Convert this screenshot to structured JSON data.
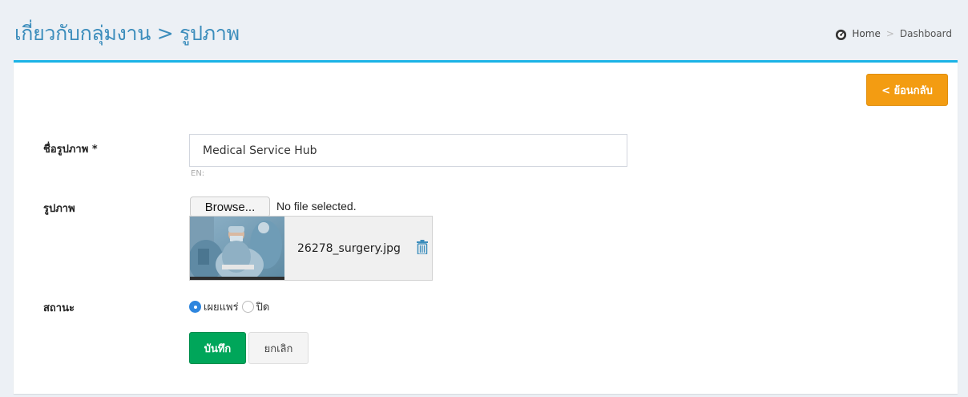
{
  "header": {
    "title": "เกี่ยวกับกลุ่มงาน > รูปภาพ",
    "breadcrumb": {
      "home_label": "Home",
      "separator": ">",
      "current_label": "Dashboard",
      "home_icon": "dashboard-icon"
    }
  },
  "toolbar": {
    "back_label": "< ย้อนกลับ"
  },
  "form": {
    "name_field": {
      "label": "ชื่อรูปภาพ *",
      "value": "Medical Service Hub",
      "hint": "EN:"
    },
    "image_field": {
      "label": "รูปภาพ",
      "browse_label": "Browse...",
      "file_status": "No file selected.",
      "current_file": "26278_surgery.jpg",
      "delete_icon": "trash-icon"
    },
    "status_field": {
      "label": "สถานะ",
      "options": [
        {
          "label": "เผยแพร่",
          "checked": true
        },
        {
          "label": "ปิด",
          "checked": false
        }
      ]
    },
    "save_label": "บันทึก",
    "cancel_label": "ยกเลิก"
  },
  "colors": {
    "accent": "#3c8dbc",
    "box_border": "#1ab3e6",
    "warning": "#f39c12",
    "success": "#00a65a"
  }
}
